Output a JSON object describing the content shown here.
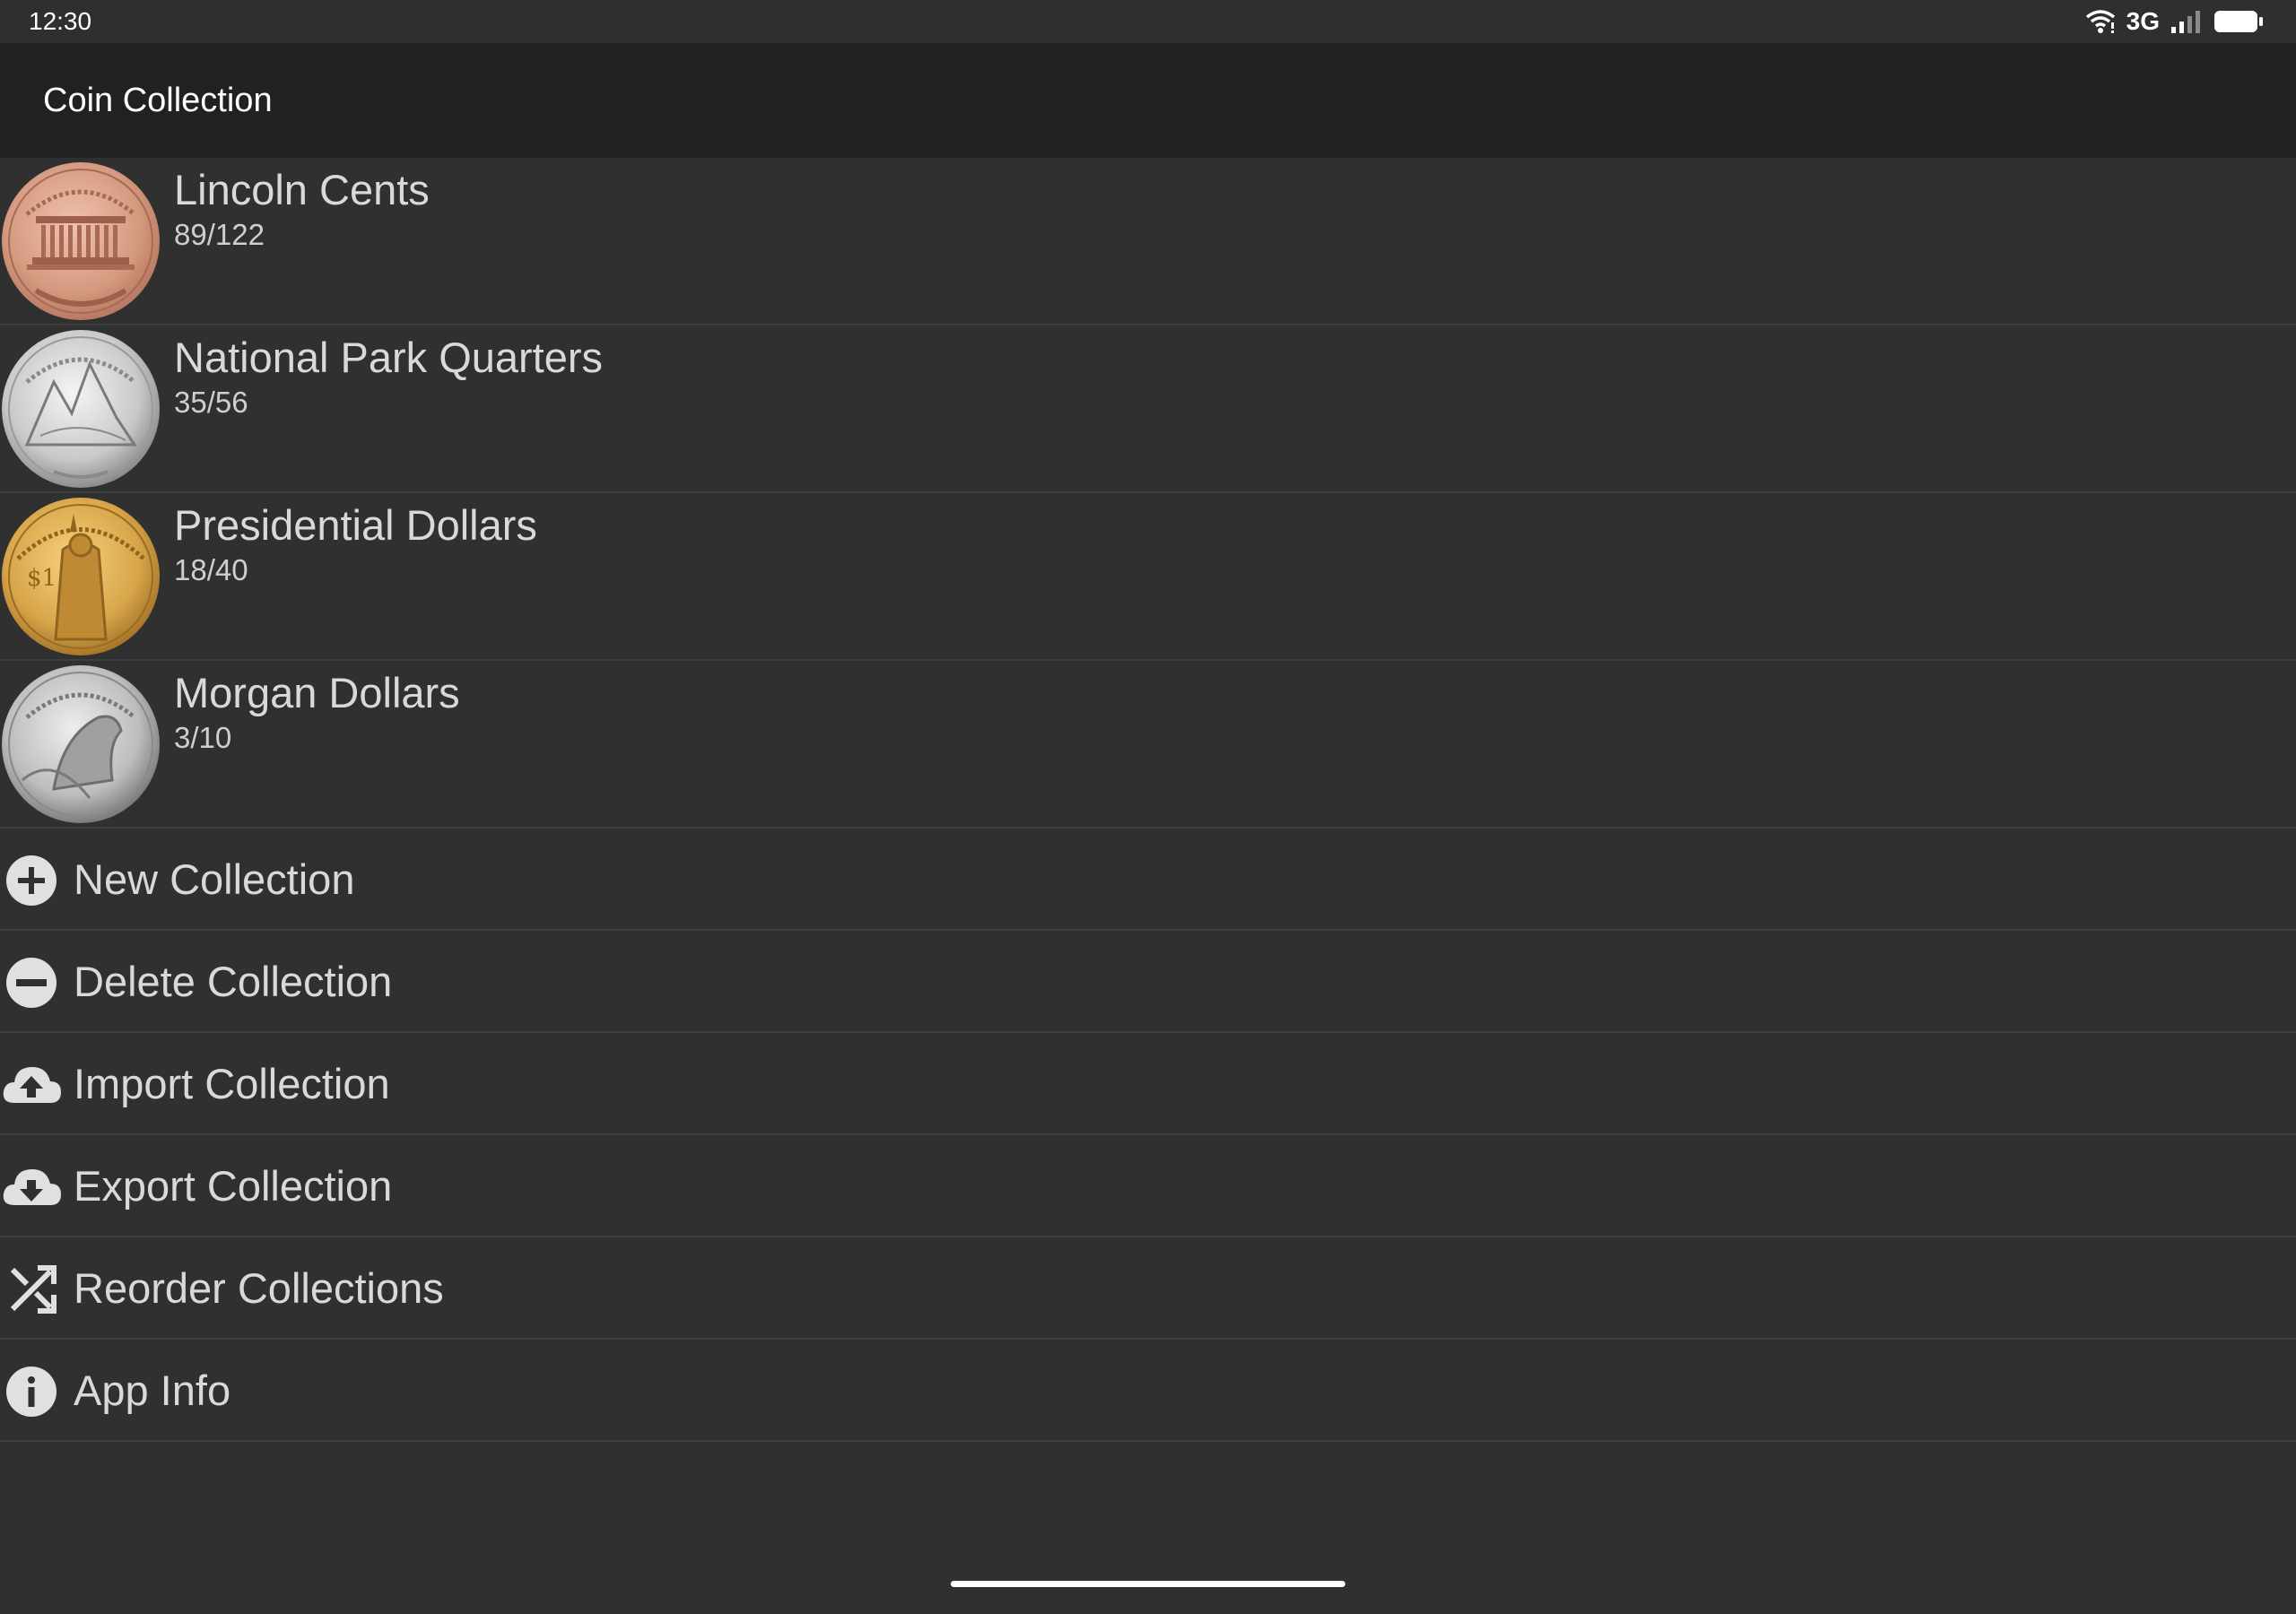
{
  "status_bar": {
    "time": "12:30",
    "network": "3G",
    "icons": [
      "wifi-icon",
      "signal-icon",
      "battery-icon"
    ]
  },
  "app_bar": {
    "title": "Coin Collection"
  },
  "collections": [
    {
      "name": "Lincoln Cents",
      "count": "89/122",
      "image": "lincoln-cent-coin",
      "color": "#d59a80"
    },
    {
      "name": "National Park Quarters",
      "count": "35/56",
      "image": "national-park-quarter-coin",
      "color": "#c9c9c9"
    },
    {
      "name": "Presidential Dollars",
      "count": "18/40",
      "image": "presidential-dollar-coin",
      "color": "#d8a54a"
    },
    {
      "name": "Morgan Dollars",
      "count": "3/10",
      "image": "morgan-dollar-coin",
      "color": "#bdbdbd"
    }
  ],
  "actions": [
    {
      "label": "New Collection",
      "icon": "plus-circle-icon"
    },
    {
      "label": "Delete Collection",
      "icon": "minus-circle-icon"
    },
    {
      "label": "Import Collection",
      "icon": "cloud-upload-icon"
    },
    {
      "label": "Export Collection",
      "icon": "cloud-download-icon"
    },
    {
      "label": "Reorder Collections",
      "icon": "shuffle-icon"
    },
    {
      "label": "App Info",
      "icon": "info-circle-icon"
    }
  ],
  "colors": {
    "background": "#303030",
    "app_bar": "#212121",
    "divider": "#3d3d3d",
    "text_primary": "#d9d9d9",
    "icon": "#e0e0e0"
  }
}
